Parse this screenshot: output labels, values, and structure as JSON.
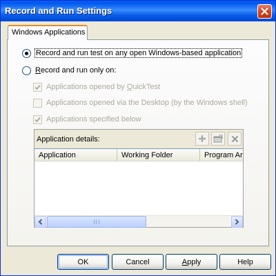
{
  "window": {
    "title": "Record and Run Settings"
  },
  "tabs": [
    {
      "label": "Windows Applications",
      "selected": true
    }
  ],
  "options": {
    "radio_any": {
      "label": "Record and run test on any open Windows-based application",
      "selected": true
    },
    "radio_only": {
      "label_pre": "R",
      "label_post": "ecord and run only on:",
      "selected": false
    },
    "check_quicktest": {
      "label_pre": "Applications opened by ",
      "label_u": "Q",
      "label_post": "uickTest",
      "checked": true,
      "enabled": false
    },
    "check_desktop": {
      "label": "Applications opened via the Desktop (by the Windows shell)",
      "checked": false,
      "enabled": false
    },
    "check_specified": {
      "label": "Applications specified below",
      "checked": true,
      "enabled": false
    }
  },
  "details": {
    "label": "Application details:",
    "columns": [
      "Application",
      "Working Folder",
      "Program Arg"
    ],
    "rows": []
  },
  "buttons": {
    "ok": "OK",
    "cancel": "Cancel",
    "apply_u": "A",
    "apply_rest": "pply",
    "help": "Help"
  },
  "colors": {
    "title_bar": "#0058ee",
    "dialog_bg": "#ece9d8",
    "tab_accent": "#e68b2c",
    "close_button": "#d5441c"
  },
  "icons": [
    "close-icon",
    "add-icon",
    "edit-icon",
    "delete-icon",
    "scroll-left-icon",
    "scroll-right-icon"
  ]
}
